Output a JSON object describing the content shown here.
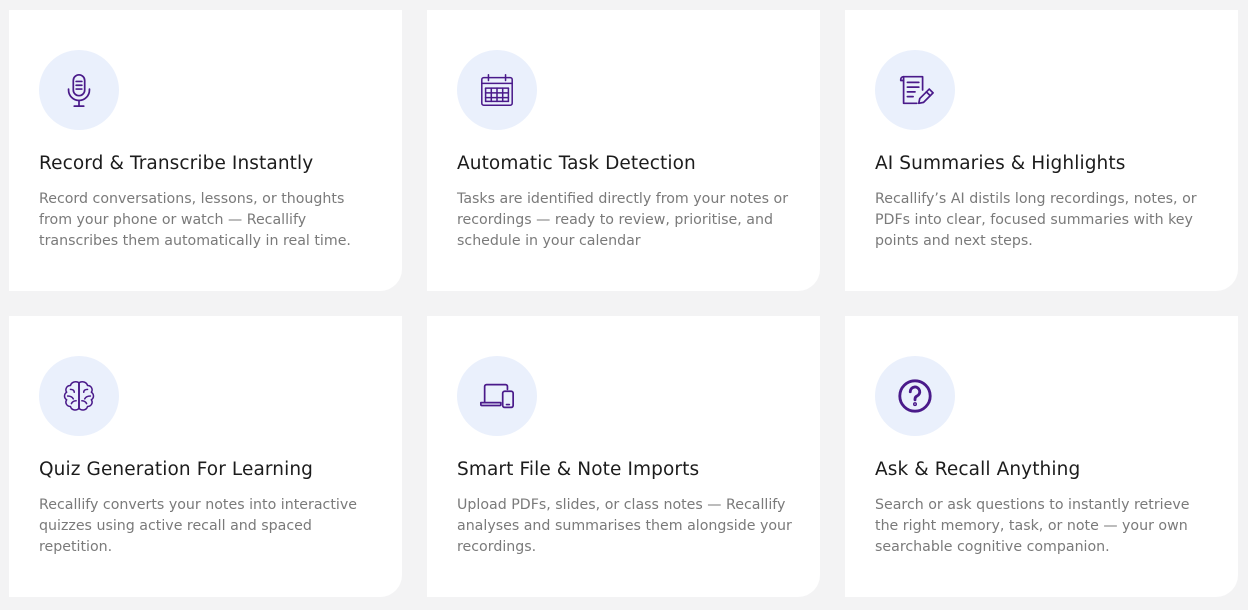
{
  "colors": {
    "accent": "#4a1a8a",
    "icon_bg": "#eaf0fc",
    "background": "#f3f3f4",
    "title": "#1c1c1c",
    "text": "#7a7a7a"
  },
  "features": [
    {
      "icon": "microphone-icon",
      "title": "Record & Transcribe Instantly",
      "description": "Record conversations, lessons, or thoughts from your phone or watch — Recallify transcribes them automatically in real time."
    },
    {
      "icon": "calendar-icon",
      "title": "Automatic Task Detection",
      "description": "Tasks are identified directly from your notes or recordings — ready to review, prioritise, and schedule in your calendar"
    },
    {
      "icon": "document-edit-icon",
      "title": "AI Summaries & Highlights",
      "description": "Recallify’s AI distils long recordings, notes, or PDFs into clear, focused summaries with key points and next steps."
    },
    {
      "icon": "brain-icon",
      "title": "Quiz Generation For Learning",
      "description": "Recallify converts your notes into interactive quizzes using active recall and spaced repetition."
    },
    {
      "icon": "devices-icon",
      "title": "Smart File & Note Imports",
      "description": "Upload PDFs, slides, or class notes — Recallify analyses and summarises them alongside your recordings."
    },
    {
      "icon": "question-icon",
      "title": "Ask & Recall Anything",
      "description": "Search or ask questions to instantly retrieve the right memory, task, or note — your own searchable cognitive companion."
    }
  ]
}
